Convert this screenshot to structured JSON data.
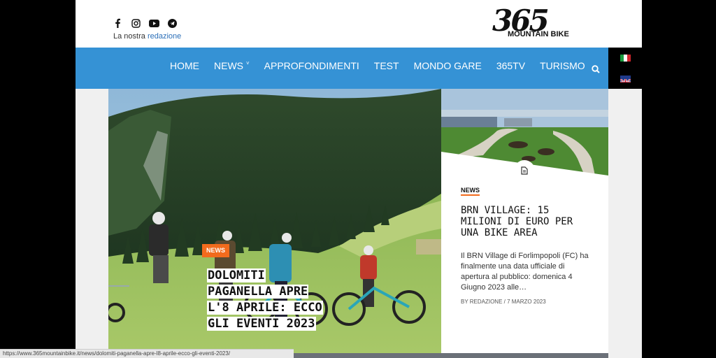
{
  "header": {
    "redazione_prefix": "La nostra",
    "redazione_link": "redazione",
    "logo_number": "365",
    "logo_text": "MOUNTAIN BIKE"
  },
  "social_icons": [
    "facebook-icon",
    "instagram-icon",
    "youtube-icon",
    "telegram-icon"
  ],
  "nav": {
    "items": [
      {
        "label": "HOME"
      },
      {
        "label": "NEWS"
      },
      {
        "label": "APPROFONDIMENTI"
      },
      {
        "label": "TEST"
      },
      {
        "label": "MONDO GARE"
      },
      {
        "label": "365TV"
      },
      {
        "label": "TURISMO"
      }
    ],
    "news_dropdown_marker": "˅"
  },
  "languages": [
    "italian-flag",
    "english-flag"
  ],
  "colors": {
    "nav_blue": "#3592d5",
    "accent_orange": "#f26b1d"
  },
  "hero": {
    "badge": "NEWS",
    "title": "DOLOMITI PAGANELLA APRE L'8 APRILE: ECCO GLI EVENTI 2023"
  },
  "side_card": {
    "category": "NEWS",
    "title": "BRN VILLAGE: 15 MILIONI DI EURO PER UNA BIKE AREA",
    "excerpt": "Il BRN Village di Forlimpopoli (FC) ha finalmente una data ufficiale di apertura al pubblico: domenica 4 Giugno 2023 alle…",
    "meta": "BY REDAZIONE  /  7 MARZO 2023"
  },
  "status_bar": {
    "url": "https://www.365mountainbike.it/news/dolomiti-paganella-apre-l8-aprile-ecco-gli-eventi-2023/"
  }
}
